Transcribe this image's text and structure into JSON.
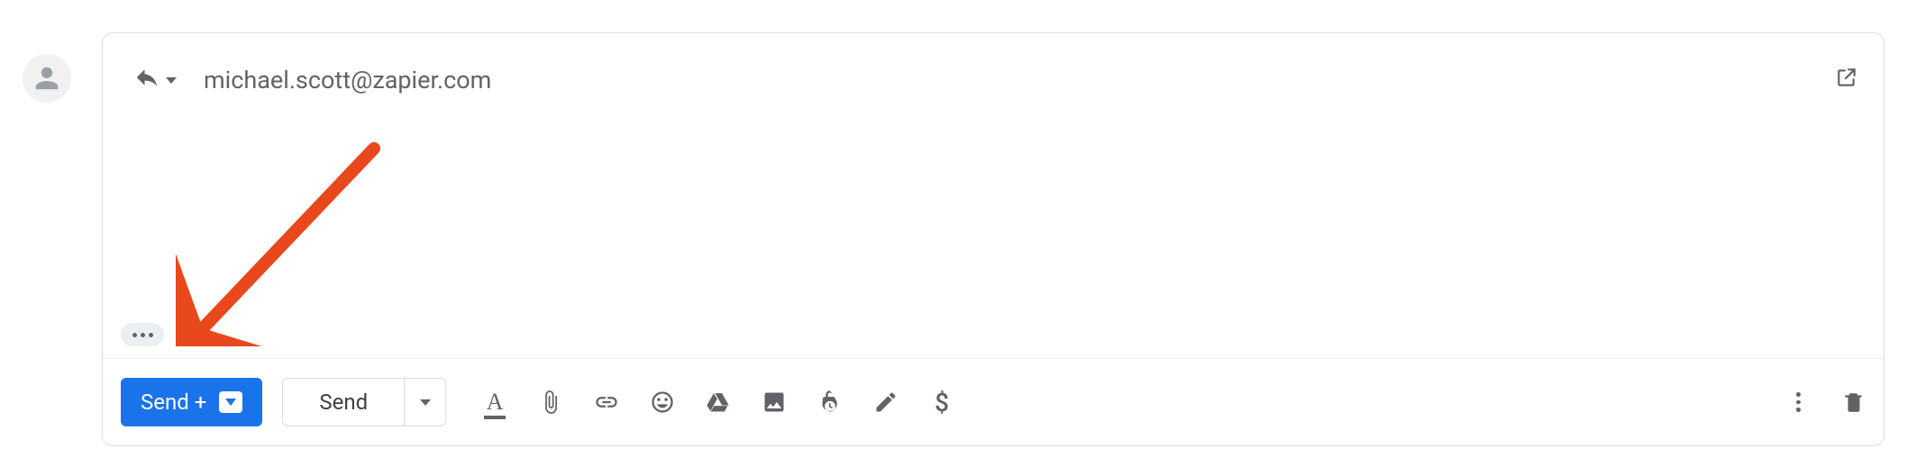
{
  "header": {
    "recipient": "michael.scott@zapier.com"
  },
  "toolbar": {
    "send_plus_label": "Send +",
    "send_label": "Send",
    "format_glyph": "A",
    "dollar_glyph": "$"
  },
  "icons": {
    "reply": "reply-icon",
    "reply_caret": "caret-down-icon",
    "popout": "open-in-new-icon",
    "trimmed": "show-trimmed-icon",
    "formatting": "text-format-icon",
    "attach": "paperclip-icon",
    "link": "link-icon",
    "emoji": "emoji-icon",
    "drive": "google-drive-icon",
    "image": "image-icon",
    "confidential": "lock-clock-icon",
    "signature": "pen-icon",
    "money": "dollar-icon",
    "more": "kebab-icon",
    "delete": "trash-icon"
  },
  "colors": {
    "accent": "#1a73e8",
    "icon": "#5f6368",
    "border": "#dadce0",
    "annotation": "#e8481b"
  }
}
